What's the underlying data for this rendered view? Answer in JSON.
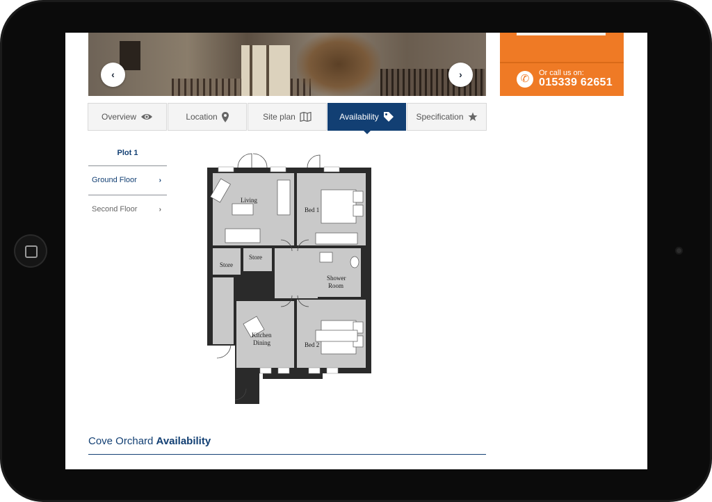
{
  "hero": {
    "prev_label": "‹",
    "next_label": "›"
  },
  "cta": {
    "call_label": "Or call us on:",
    "phone_number": "015339 62651",
    "phone_icon": "phone-icon"
  },
  "tabs": [
    {
      "label": "Overview",
      "icon": "eye-icon"
    },
    {
      "label": "Location",
      "icon": "map-pin-icon"
    },
    {
      "label": "Site plan",
      "icon": "map-icon"
    },
    {
      "label": "Availability",
      "icon": "tag-icon"
    },
    {
      "label": "Specification",
      "icon": "star-icon"
    }
  ],
  "active_tab": "Availability",
  "plot_nav": {
    "title": "Plot 1",
    "floors": [
      {
        "label": "Ground Floor",
        "chevron": "›"
      },
      {
        "label": "Second Floor",
        "chevron": "›"
      }
    ]
  },
  "floor_plan": {
    "rooms": {
      "living": "Living",
      "bed1": "Bed 1",
      "store1": "Store",
      "store2": "Store",
      "shower": [
        "Shower",
        "Room"
      ],
      "kitchen": [
        "Kitchen",
        "Dining"
      ],
      "bed2": "Bed 2"
    }
  },
  "availability": {
    "title_prefix": "Cove Orchard",
    "title_suffix": "Availability"
  },
  "colors": {
    "brand_blue": "#123f73",
    "cta_orange": "#ef7a25",
    "room_grey": "#c9c9c9",
    "wall": "#2a2a2a"
  }
}
